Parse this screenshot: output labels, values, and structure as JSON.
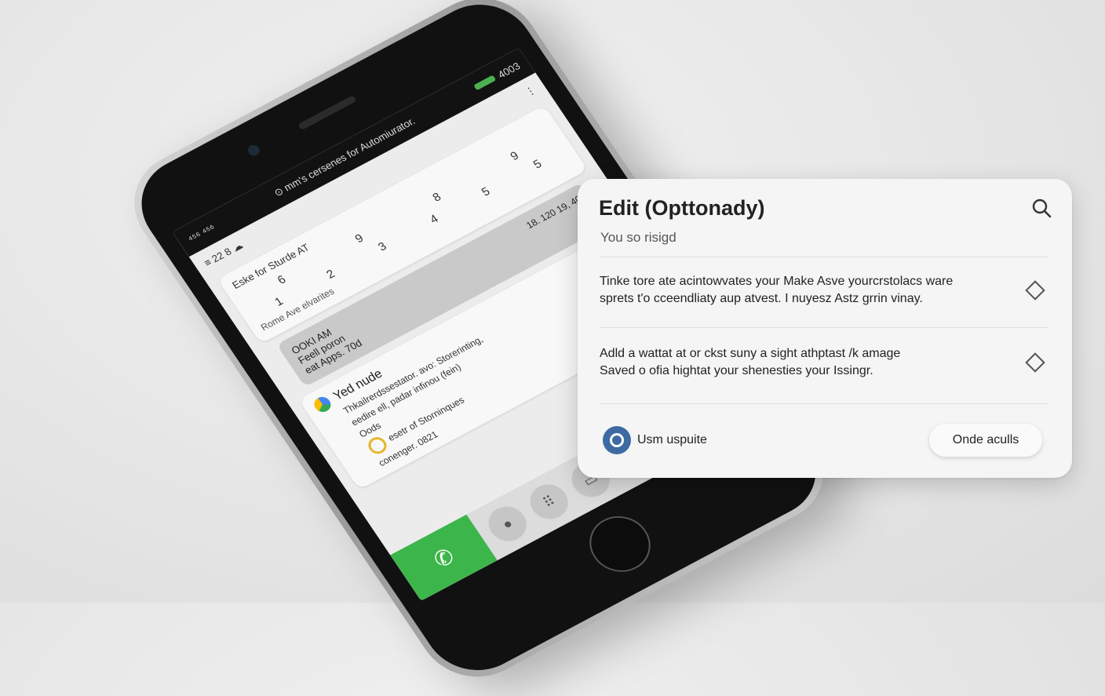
{
  "phone": {
    "statusbar": {
      "left_text": "⁴⁵⁶ ⁴⁵⁶",
      "center_text": "⊙ mm's cersenes for Automiurator.",
      "right_text": "4003"
    },
    "app_header": {
      "time": "≡ 22 8 ☁",
      "menu_glyph": "⋮"
    },
    "dial_card": {
      "title": "Eske for Sturde AT",
      "digits_top": [
        "6",
        "9",
        "8",
        "9"
      ],
      "digits_bottom": [
        "1",
        "2",
        "3",
        "4",
        "5",
        "5"
      ],
      "caption": "Rome Ave elvarites"
    },
    "gray_card": {
      "stamp": "18. 120 19, 40",
      "lines": [
        "OOKI AM",
        "Feell poron",
        "eat Apps. 70d"
      ]
    },
    "notification": {
      "title": "Yed nude",
      "line1": "Thkailrerdssestator. avo: Storerinting,",
      "line2": "eedire ell, padar infinou (fein)",
      "line3": "Oods",
      "line4": "esetr of Storninques",
      "line5": "conenger. 0821"
    },
    "dock": {
      "call_icon": "✆",
      "chat_icon": "●",
      "dialpad_icon": "⠿",
      "switch_icon": "▭"
    }
  },
  "overlay": {
    "title": "Edit (Opttonady)",
    "subtitle": "You so risigd",
    "rows": [
      {
        "line1": "Tinke tore ate acintowvates your Make Asve yourcrstolacs ware",
        "line2": "sprets t'o cceendliaty aup atvest. I nuyesz Astz grrin vinay."
      },
      {
        "line1": "Adld a wattat at or ckst suny a sight athptast /k amage",
        "line2": "Saved o ofia hightat your shenesties your Issingr."
      }
    ],
    "footer_label": "Usm uspuite",
    "button_label": "Onde aculls",
    "icons": {
      "search": "search-icon",
      "row": "diamond-icon",
      "user": "user-icon"
    }
  }
}
